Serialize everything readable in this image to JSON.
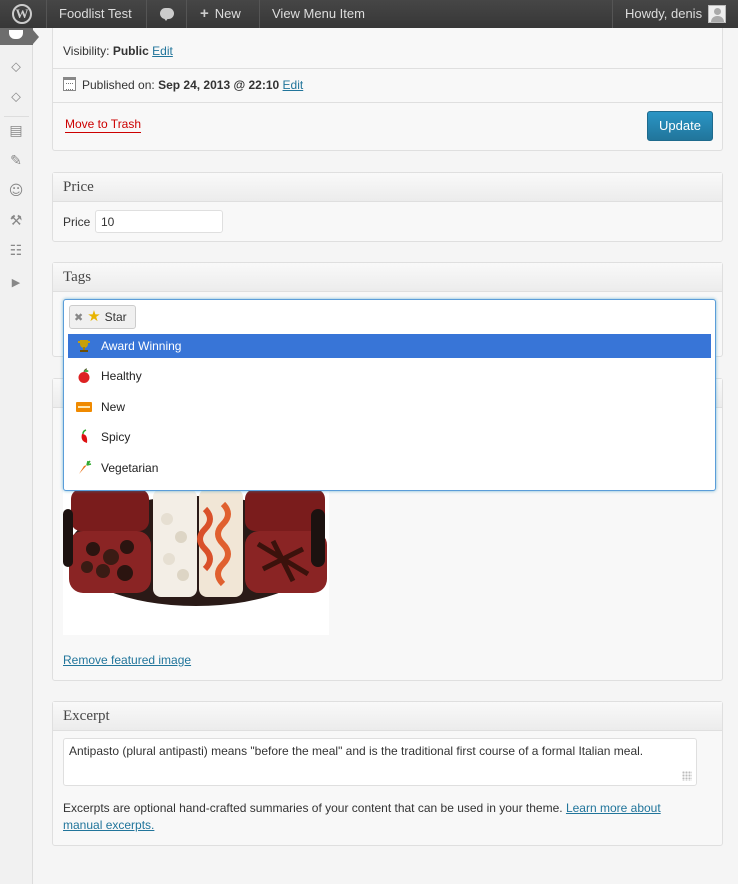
{
  "adminbar": {
    "wp_logo": "W",
    "site_name": "Foodlist Test",
    "new_label": "New",
    "view_label": "View Menu Item",
    "howdy": "Howdy, denis"
  },
  "sidebar": {
    "icons": [
      "food-menu-icon",
      "comments-icon",
      "comments-alt-icon",
      "appearance-icon",
      "plugins-icon",
      "users-icon",
      "tools-icon",
      "settings-icon",
      "collapse-icon"
    ]
  },
  "publish": {
    "visibility_label": "Visibility:",
    "visibility_value": "Public",
    "edit_label": "Edit",
    "published_label": "Published on:",
    "published_value": "Sep 24, 2013 @ 22:10",
    "trash_label": "Move to Trash",
    "update_label": "Update"
  },
  "price": {
    "title": "Price",
    "label": "Price",
    "value": "10"
  },
  "tags": {
    "title": "Tags",
    "selected_token": "Star",
    "options": [
      {
        "label": "Award Winning",
        "icon": "trophy-icon",
        "selected": true
      },
      {
        "label": "Healthy",
        "icon": "apple-icon",
        "selected": false
      },
      {
        "label": "New",
        "icon": "new-badge-icon",
        "selected": false
      },
      {
        "label": "Spicy",
        "icon": "chili-icon",
        "selected": false
      },
      {
        "label": "Vegetarian",
        "icon": "carrot-icon",
        "selected": false
      }
    ]
  },
  "featured": {
    "remove_label": "Remove featured image"
  },
  "excerpt": {
    "title": "Excerpt",
    "value": "Antipasto (plural antipasti) means \"before the meal\" and is the traditional first course of a formal Italian meal.",
    "help_text": "Excerpts are optional hand-crafted summaries of your content that can be used in your theme.",
    "help_link": "Learn more about manual excerpts."
  },
  "colors": {
    "adminbar": "#464646",
    "accent": "#21759b",
    "selected_option": "#3875d7",
    "trash": "#cc0000"
  }
}
